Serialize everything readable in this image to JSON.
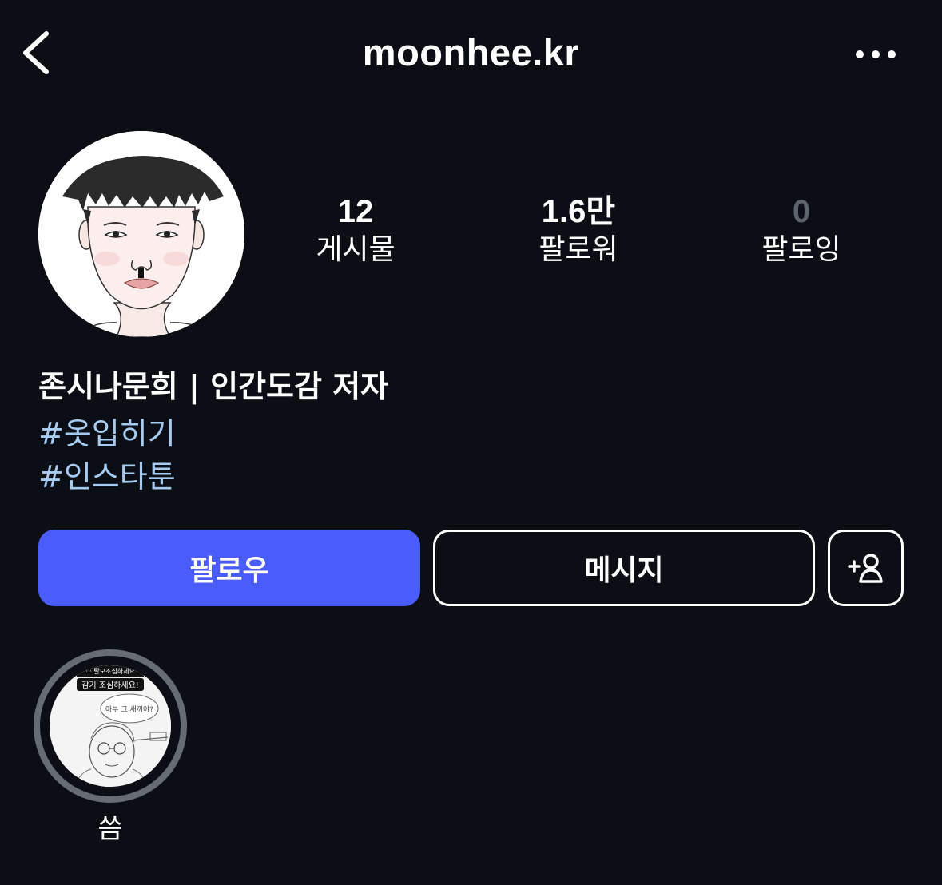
{
  "header": {
    "back_icon": "chevron-left-icon",
    "username": "moonhee.kr",
    "more_icon": "ellipsis-horizontal-icon"
  },
  "profile": {
    "avatar_description": "illustrated self portrait",
    "stats": [
      {
        "value": "12",
        "label": "게시물"
      },
      {
        "value": "1.6만",
        "label": "팔로워"
      },
      {
        "value": "0",
        "label": "팔로잉"
      }
    ]
  },
  "bio": {
    "name_line": "존시나문희 | 인간도감 저자",
    "hashtags": [
      "#옷입히기",
      "#인스타툰"
    ]
  },
  "actions": {
    "follow_label": "팔로우",
    "message_label": "메시지",
    "add_person_icon": "add-person-icon"
  },
  "highlights": [
    {
      "label": "씀",
      "thumb_caption_top": "· · 탈모조심하세요",
      "thumb_caption": "감기 조심하세요!",
      "thumb_bubble": "아부 그 새끼야?"
    }
  ],
  "colors": {
    "background": "#0b0e14",
    "follow_button": "#4a5dfa",
    "hashtag": "#a6cbf2",
    "muted_stat": "#5e636d",
    "highlight_ring": "#676b73"
  }
}
